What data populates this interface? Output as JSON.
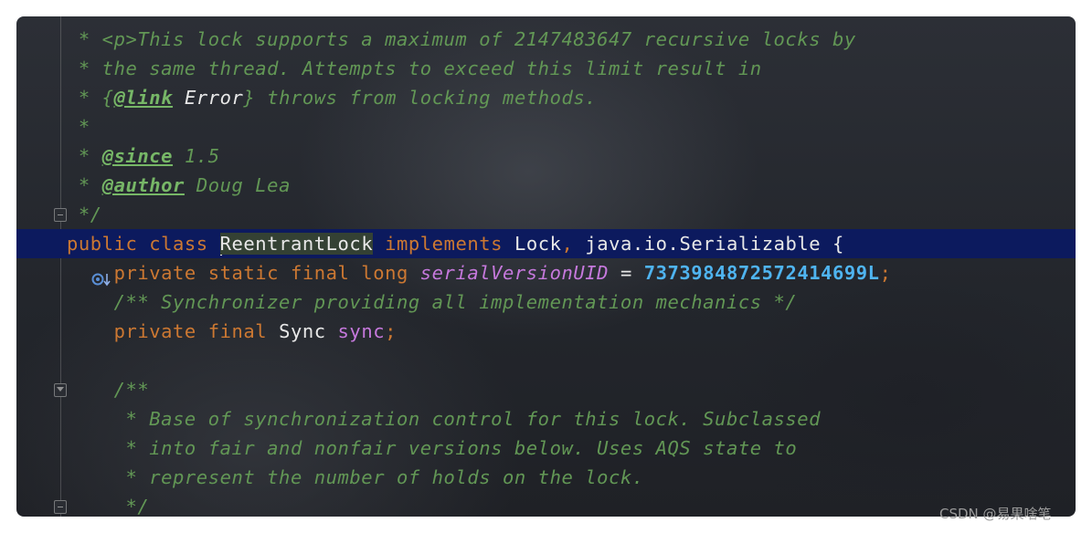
{
  "editor": {
    "lines": [
      {
        "parts": [
          " * <p>This lock supports a maximum of 2147483647 recursive locks by"
        ]
      },
      {
        "parts": [
          " * the same thread. Attempts to exceed this limit result in"
        ]
      },
      {
        "parts": [
          " * {",
          "@link",
          " ",
          "Error",
          "} throws from locking methods."
        ]
      },
      {
        "parts": [
          " *"
        ]
      },
      {
        "parts": [
          " * ",
          "@since",
          " 1.5"
        ]
      },
      {
        "parts": [
          " * ",
          "@author",
          " Doug Lea"
        ]
      },
      {
        "parts": [
          " */"
        ]
      },
      {
        "parts": [
          "public class ",
          "ReentrantLock",
          " implements ",
          "Lock",
          ", ",
          "java.io.Serializable {"
        ]
      },
      {
        "parts": [
          "    private static final long ",
          "serialVersionUID",
          " = ",
          "7373984872572414699L",
          ";"
        ]
      },
      {
        "parts": [
          "    /** Synchronizer providing all implementation mechanics */"
        ]
      },
      {
        "parts": [
          "    private final ",
          "Sync ",
          "sync",
          ";"
        ]
      },
      {
        "parts": [
          ""
        ]
      },
      {
        "parts": [
          "    /**"
        ]
      },
      {
        "parts": [
          "     * Base of synchronization control for this lock. Subclassed"
        ]
      },
      {
        "parts": [
          "     * into fair and nonfair versions below. Uses AQS state to"
        ]
      },
      {
        "parts": [
          "     * represent the number of holds on the lock."
        ]
      },
      {
        "parts": [
          "     */"
        ]
      }
    ],
    "gutter_icon": "implemented-interface-icon",
    "colors": {
      "background": "#252830",
      "comment": "#629755",
      "keyword": "#cc7832",
      "field": "#c679dd",
      "number": "#4fb4f0",
      "highlight_line": "#0c1a5e"
    }
  },
  "watermark": "CSDN @易果啥笔"
}
